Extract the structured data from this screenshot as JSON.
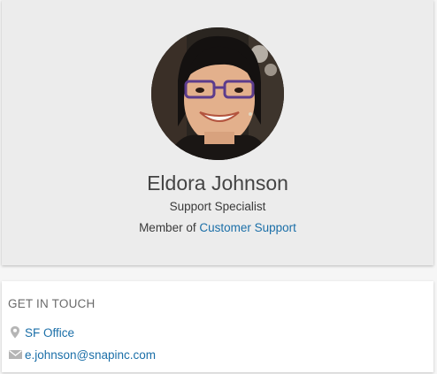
{
  "profile": {
    "name": "Eldora Johnson",
    "job_title": "Support Specialist",
    "member_prefix": "Member of",
    "team_link": "Customer Support"
  },
  "contact": {
    "heading": "GET IN TOUCH",
    "office_link": "SF Office",
    "email_link": "e.johnson@snapinc.com",
    "office_icon": "location-pin-icon",
    "email_icon": "envelope-icon"
  },
  "colors": {
    "link": "#1b6fa8",
    "card_background": "#ececec",
    "icon_gray": "#b5b5b5"
  }
}
